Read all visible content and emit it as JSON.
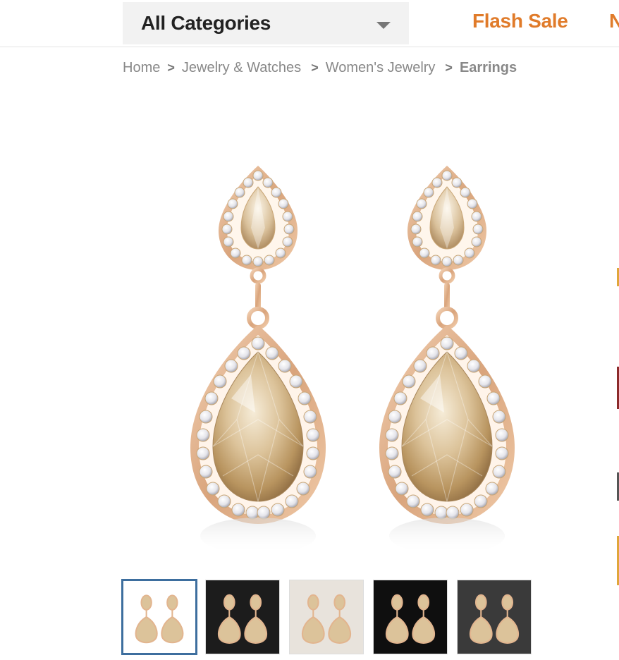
{
  "header": {
    "category_select": {
      "selected": "All Categories"
    },
    "nav": [
      {
        "label": "Flash Sale"
      },
      {
        "label": "N"
      }
    ]
  },
  "breadcrumb": [
    {
      "label": "Home"
    },
    {
      "label": "Jewelry & Watches"
    },
    {
      "label": "Women's Jewelry"
    },
    {
      "label": "Earrings",
      "current": true
    }
  ],
  "separator": ">",
  "colors": {
    "accent": "#e07b2a",
    "thumb_active_border": "#3d6e9e",
    "gold": "#e2b58f",
    "crystal": "#dcc39a"
  },
  "gallery": {
    "main_image_icon": "teardrop-crystal-earrings",
    "thumbnails": [
      {
        "background": "#ffffff",
        "icon": "earrings-thumbnail"
      },
      {
        "background": "#1c1c1c",
        "icon": "earrings-thumbnail"
      },
      {
        "background": "#e8e3dc",
        "icon": "earrings-thumbnail"
      },
      {
        "background": "#0f0f0f",
        "icon": "earrings-thumbnail"
      },
      {
        "background": "#3a3a3a",
        "icon": "earrings-thumbnail"
      }
    ],
    "active_index": 0
  }
}
